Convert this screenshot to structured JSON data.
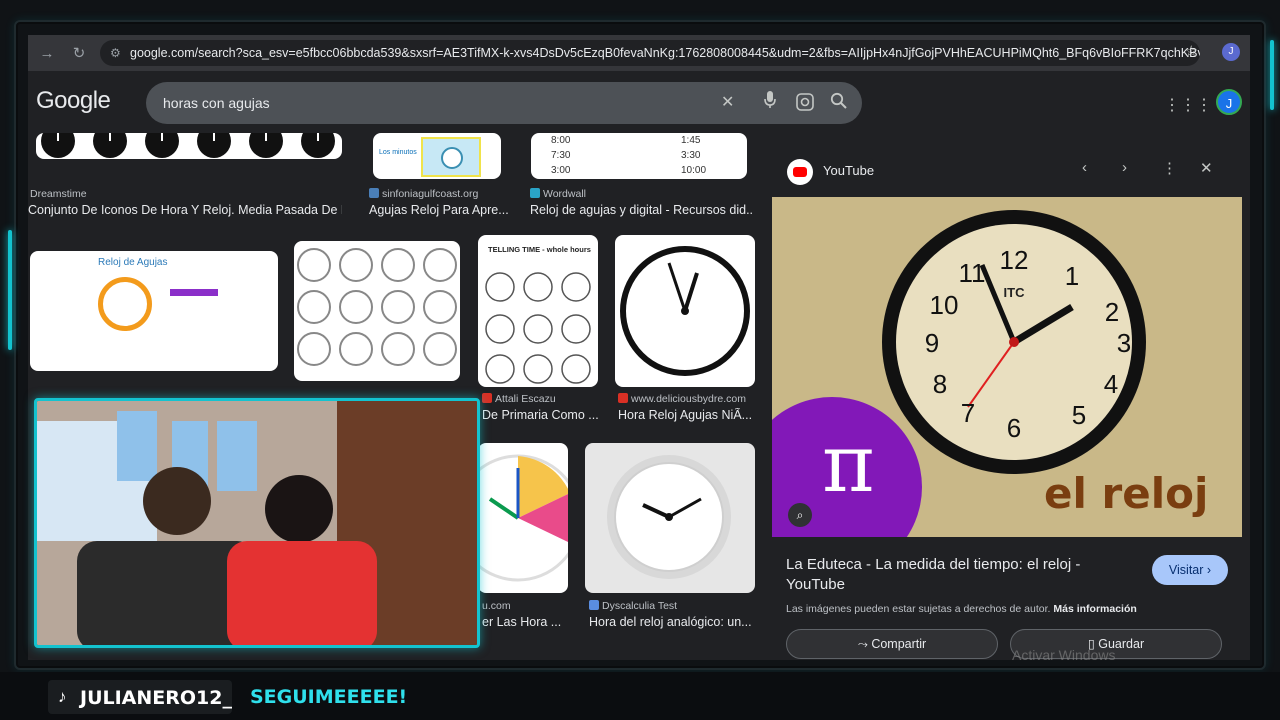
{
  "browser": {
    "url": "google.com/search?sca_esv=e5fbcc06bbcda539&sxsrf=AE3TifMX-k-xvs4DsDv5cEzqB0fevaNnKg:1762808008445&udm=2&fbs=AIIjpHx4nJjfGojPVHhEACUHPiMQht6_BFq6vBIoFFRK7qchKBv8IM7dq8CE...",
    "profile_initial": "J"
  },
  "search": {
    "logo": "Google",
    "query": "horas con agujas"
  },
  "results": [
    {
      "source": "Dreamstime",
      "title": "Conjunto De Iconos De Hora Y Reloj. Media Pasada De L..."
    },
    {
      "source": "sinfoniagulfcoast.org",
      "title": "Agujas Reloj Para Apre..."
    },
    {
      "source": "Wordwall",
      "title": "Reloj de agujas y digital - Recursos did..."
    },
    {
      "source": "Attali Escazu",
      "title": "De Primaria Como ..."
    },
    {
      "source": "www.deliciousbydre.com",
      "title": "Hora Reloj Agujas NiÃ..."
    },
    {
      "source": "u.com",
      "title": "er Las Hora ..."
    },
    {
      "source": "Dyscalculia Test",
      "title": "Hora del reloj analógico: un..."
    }
  ],
  "thumb_texts": {
    "reloj_agujas": "Reloj de Agujas",
    "telling_time": "TELLING TIME - whole hours",
    "wordwall_times": [
      "8:00",
      "7:30",
      "3:00",
      "1:45",
      "3:30",
      "10:00"
    ],
    "minutos": "Los minutos"
  },
  "panel": {
    "source": "YouTube",
    "title": "La Eduteca - La medida del tiempo: el reloj - YouTube",
    "visit_label": "Visitar",
    "copyright": "Las imágenes pueden estar sujetas a derechos de autor.",
    "more_info": "Más información",
    "share_label": "Compartir",
    "save_label": "Guardar",
    "image_overlay_text": "el reloj",
    "clock_brand": "ITC",
    "watermark": "Activar Windows"
  },
  "overlay": {
    "handle": "JULIANERO12_",
    "slogan": "SEGUIMEEEEE!"
  },
  "colors": {
    "accent": "#13c3cf",
    "slogan": "#2fe0ec",
    "visit_button": "#a8c7fa"
  }
}
